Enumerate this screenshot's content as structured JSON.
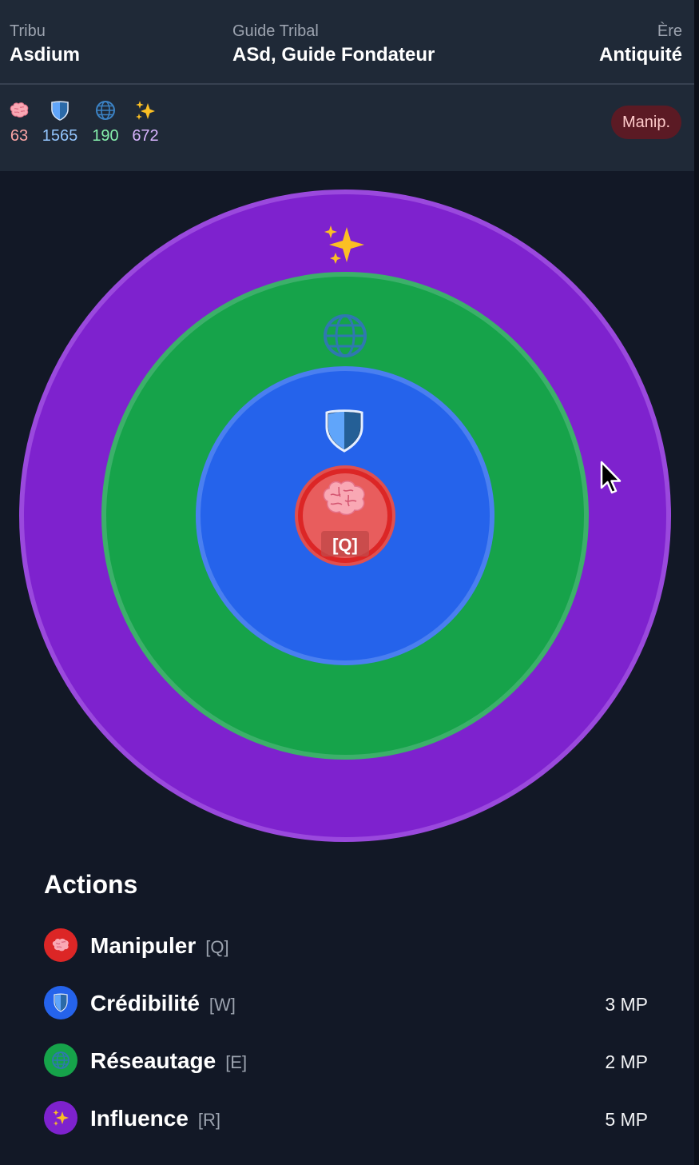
{
  "header": {
    "tribe": {
      "label": "Tribu",
      "value": "Asdium"
    },
    "guide": {
      "label": "Guide Tribal",
      "value": "ASd, Guide Fondateur"
    },
    "era": {
      "label": "Ère",
      "value": "Antiquité"
    }
  },
  "stats": [
    {
      "icon": "brain-icon",
      "value": "63",
      "color": "#fca5a5"
    },
    {
      "icon": "shield-icon",
      "value": "1565",
      "color": "#93c5fd"
    },
    {
      "icon": "globe-icon",
      "value": "190",
      "color": "#86efac"
    },
    {
      "icon": "sparkles-icon",
      "value": "672",
      "color": "#d8b4fe"
    }
  ],
  "mode_badge": "Manip.",
  "target": {
    "center_key": "[Q]",
    "rings": [
      {
        "name": "influence",
        "color": "#7e22ce",
        "icon": "sparkles-icon"
      },
      {
        "name": "networking",
        "color": "#16a34a",
        "icon": "globe-icon"
      },
      {
        "name": "credibility",
        "color": "#2563eb",
        "icon": "shield-icon"
      },
      {
        "name": "manipulate",
        "color": "#dc2626",
        "icon": "brain-icon"
      }
    ]
  },
  "actions": {
    "title": "Actions",
    "items": [
      {
        "name": "Manipuler",
        "key": "[Q]",
        "cost": "",
        "color": "#dc2626",
        "icon": "brain-icon"
      },
      {
        "name": "Crédibilité",
        "key": "[W]",
        "cost": "3 MP",
        "color": "#2563eb",
        "icon": "shield-icon"
      },
      {
        "name": "Réseautage",
        "key": "[E]",
        "cost": "2 MP",
        "color": "#16a34a",
        "icon": "globe-icon"
      },
      {
        "name": "Influence",
        "key": "[R]",
        "cost": "5 MP",
        "color": "#7e22ce",
        "icon": "sparkles-icon"
      }
    ]
  }
}
